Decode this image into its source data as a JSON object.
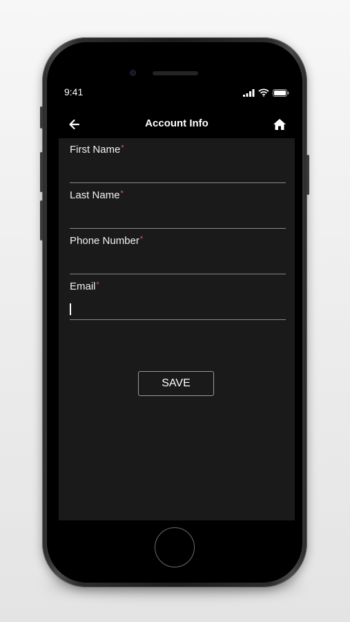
{
  "status_bar": {
    "time": "9:41"
  },
  "nav": {
    "title": "Account Info",
    "back_icon": "arrow-left-icon",
    "home_icon": "home-icon"
  },
  "form": {
    "fields": [
      {
        "label": "First Name",
        "required_mark": "*",
        "value": ""
      },
      {
        "label": "Last Name",
        "required_mark": "*",
        "value": ""
      },
      {
        "label": "Phone Number",
        "required_mark": "*",
        "value": ""
      },
      {
        "label": "Email",
        "required_mark": "*",
        "value": ""
      }
    ],
    "save_label": "SAVE"
  },
  "colors": {
    "screen_background": "#1a1a1a",
    "header_background": "#000000",
    "text": "#ffffff",
    "required_mark": "#e15a6a",
    "underline": "#8a8a8a"
  }
}
